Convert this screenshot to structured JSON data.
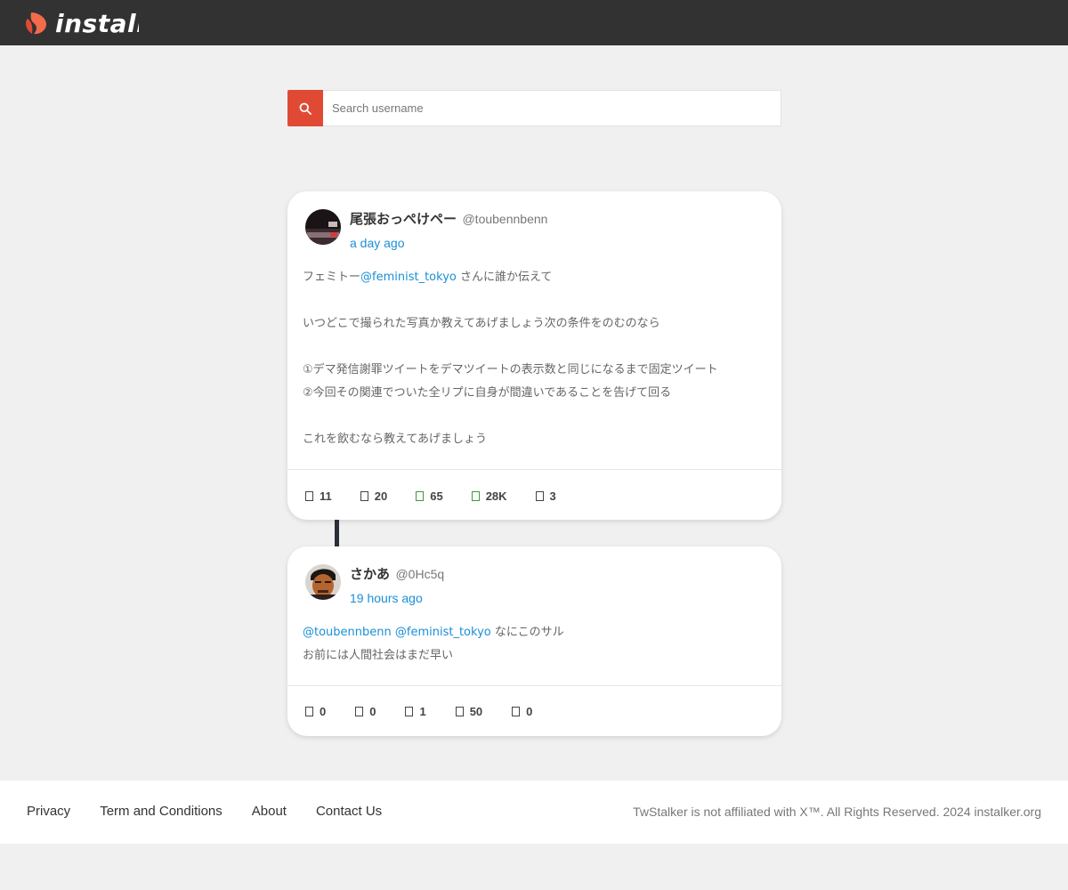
{
  "header": {
    "logo_text": "instalk"
  },
  "search": {
    "placeholder": "Search username"
  },
  "posts": [
    {
      "display_name": "尾張おっぺけペー",
      "handle": "@toubennbenn",
      "time": "a day ago",
      "lines": [
        [
          "フェミトー",
          "@feminist_tokyo",
          " さんに誰か伝えて"
        ],
        [
          "",
          "",
          ""
        ],
        [
          "いつどこで撮られた写真か教えてあげましょう次の条件をのむのなら",
          "",
          ""
        ],
        [
          "",
          "",
          ""
        ],
        [
          "①デマ発信謝罪ツイートをデマツイートの表示数と同じになるまで固定ツイート",
          "",
          ""
        ],
        [
          "②今回その関連でついた全リプに自身が間違いであることを告げて回る",
          "",
          ""
        ],
        [
          "",
          "",
          ""
        ],
        [
          "これを飲むなら教えてあげましょう",
          "",
          ""
        ]
      ],
      "stats": {
        "replies": "11",
        "retweets": "20",
        "likes": "65",
        "views": "28K",
        "bookmarks": "3"
      }
    },
    {
      "display_name": "さかあ",
      "handle": "@0Hc5q",
      "time": "19 hours ago",
      "lines": [
        [
          "",
          "@toubennbenn",
          " ",
          "@feminist_tokyo",
          " なにこのサル"
        ],
        [
          "お前には人間社会はまだ早い",
          "",
          "",
          "",
          ""
        ]
      ],
      "stats": {
        "replies": "0",
        "retweets": "0",
        "likes": "1",
        "views": "50",
        "bookmarks": "0"
      }
    }
  ],
  "footer": {
    "links": [
      "Privacy",
      "Term and Conditions",
      "About",
      "Contact Us"
    ],
    "copyright": "TwStalker is not affiliated with X™. All Rights Reserved.  2024 instalker.org"
  },
  "colors": {
    "topbar": "#323232",
    "accent": "#e04a35",
    "link": "#1a8fd6",
    "background": "#f0f0f0"
  }
}
